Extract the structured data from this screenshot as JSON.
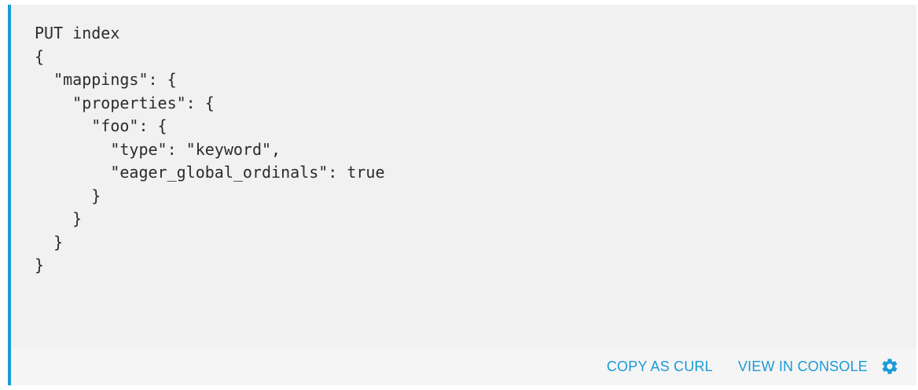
{
  "code": {
    "lines": [
      "PUT index",
      "{",
      "  \"mappings\": {",
      "    \"properties\": {",
      "      \"foo\": {",
      "        \"type\": \"keyword\",",
      "        \"eager_global_ordinals\": true",
      "      }",
      "    }",
      "  }",
      "}"
    ]
  },
  "toolbar": {
    "copy_as_curl": "COPY AS CURL",
    "view_in_console": "VIEW IN CONSOLE",
    "settings_icon": "gear-icon"
  },
  "colors": {
    "accent": "#1b9ad7",
    "code_background": "#f1f1f1",
    "text": "#2b2b2b"
  }
}
